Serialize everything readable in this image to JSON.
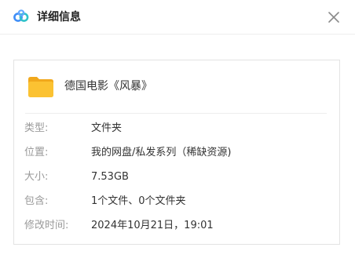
{
  "header": {
    "title": "详细信息",
    "logo_icon": "cloud-logo-icon",
    "close_icon": "close-icon"
  },
  "file": {
    "icon": "folder-icon",
    "name": "德国电影《风暴》"
  },
  "details": [
    {
      "label": "类型:",
      "value": "文件夹"
    },
    {
      "label": "位置:",
      "value": "我的网盘/私发系列（稀缺资源)"
    },
    {
      "label": "大小:",
      "value": "7.53GB"
    },
    {
      "label": "包含:",
      "value": "1个文件、0个文件夹"
    },
    {
      "label": "修改时间:",
      "value": "2024年10月21日，19:01"
    }
  ],
  "colors": {
    "accent_blue": "#3f8ef7",
    "accent_teal": "#30c2c9",
    "folder_yellow": "#fbc232",
    "label_gray": "#9a9a9a"
  }
}
